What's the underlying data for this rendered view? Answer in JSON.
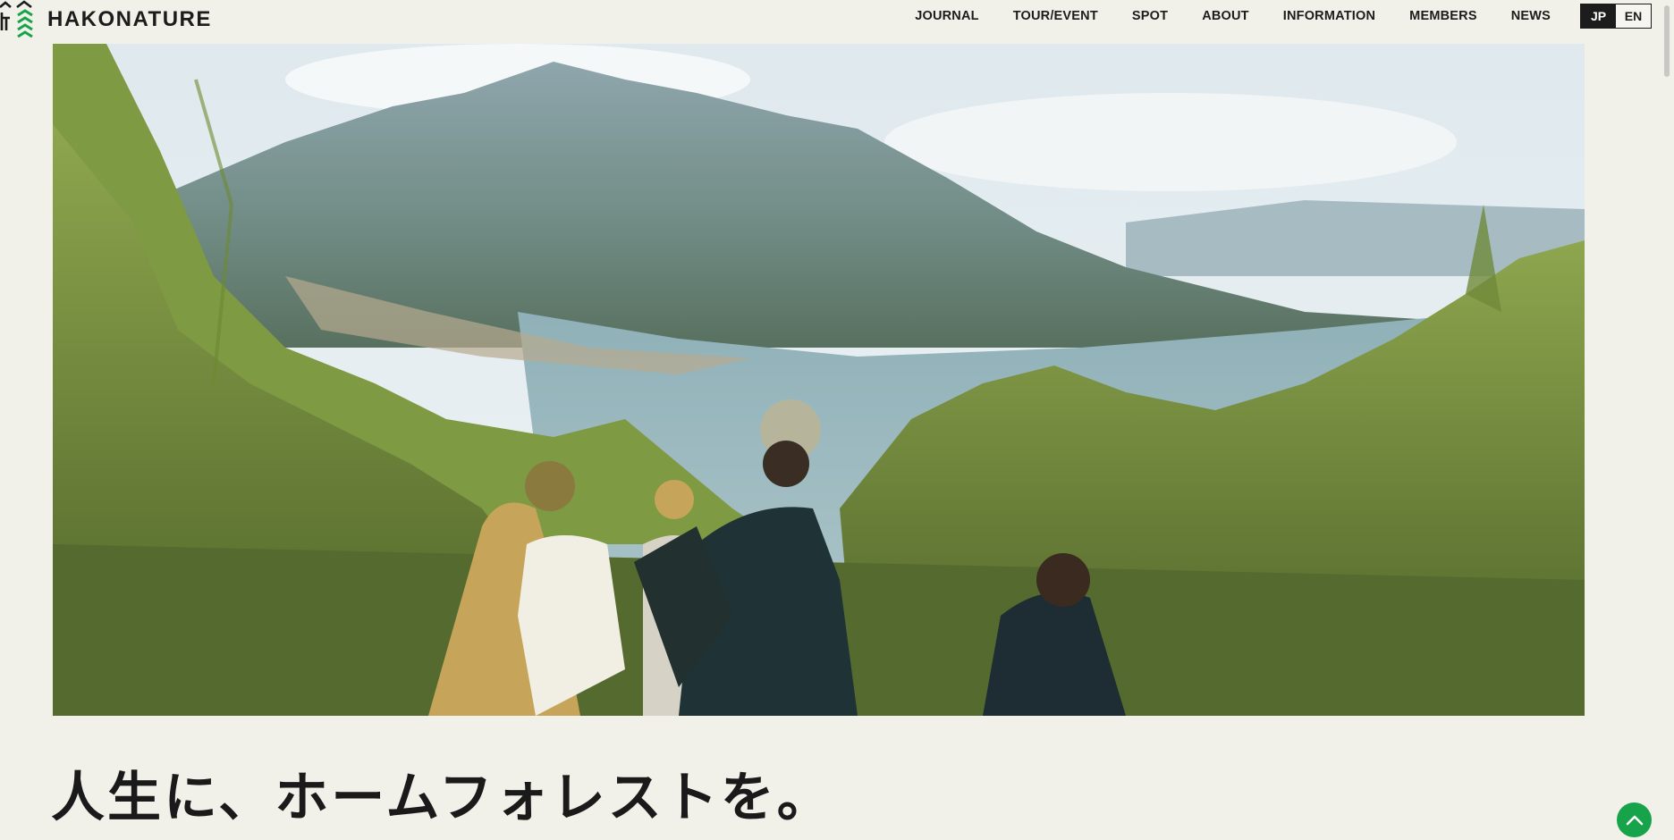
{
  "site": {
    "logo_text": "HAKONATURE",
    "logo_icon": "hakonature-logo-mark"
  },
  "nav": {
    "items": [
      {
        "label": "JOURNAL"
      },
      {
        "label": "TOUR/EVENT"
      },
      {
        "label": "SPOT"
      },
      {
        "label": "ABOUT"
      },
      {
        "label": "INFORMATION"
      },
      {
        "label": "MEMBERS"
      },
      {
        "label": "NEWS"
      }
    ]
  },
  "language": {
    "options": [
      {
        "label": "JP",
        "active": true
      },
      {
        "label": "EN",
        "active": false
      }
    ]
  },
  "hero": {
    "image": "hikers-overlooking-lake-and-mountain"
  },
  "tagline": "人生に、ホームフォレストを。",
  "back_to_top": {
    "icon": "chevron-up-icon"
  },
  "colors": {
    "background": "#f1f0e9",
    "text": "#1c1c1c",
    "accent_green": "#17a34a"
  }
}
